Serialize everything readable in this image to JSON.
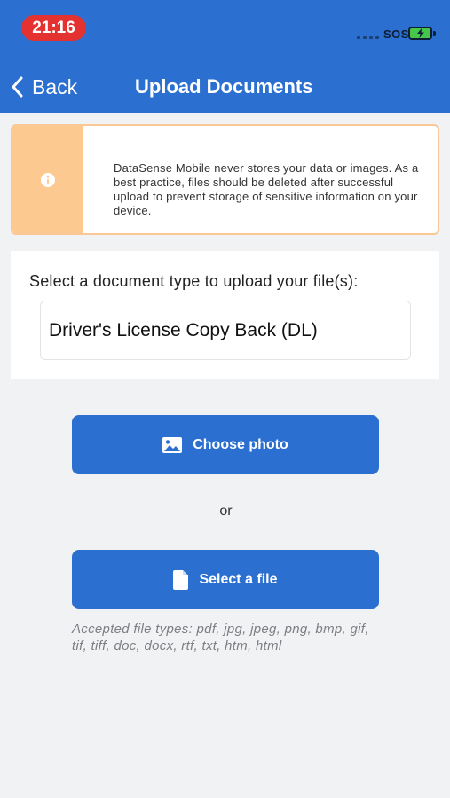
{
  "status_bar": {
    "time": "21:16",
    "sos_label": "SOS",
    "time_pill_color": "#e3322f",
    "battery_color": "#47c64c"
  },
  "nav": {
    "back_label": "Back",
    "title": "Upload Documents",
    "back_icon": "chevron-left-icon",
    "header_color": "#2b6fd0"
  },
  "notice": {
    "icon": "info-icon",
    "text": "DataSense Mobile never stores your data or images. As a best practice, files should be deleted after successful upload to prevent storage of sensitive information on your device.",
    "accent_color": "#fcc991"
  },
  "document_type": {
    "label": "Select a document type to upload your file(s):",
    "selected": "Driver's License Copy Back (DL)"
  },
  "actions": {
    "choose_photo_label": "Choose photo",
    "choose_photo_icon": "image-icon",
    "divider_text": "or",
    "select_file_label": "Select a file",
    "select_file_icon": "file-icon",
    "button_color": "#2b6fd0"
  },
  "accepted_types": "Accepted file types: pdf, jpg, jpeg, png, bmp, gif, tif, tiff, doc, docx, rtf, txt, htm, html"
}
